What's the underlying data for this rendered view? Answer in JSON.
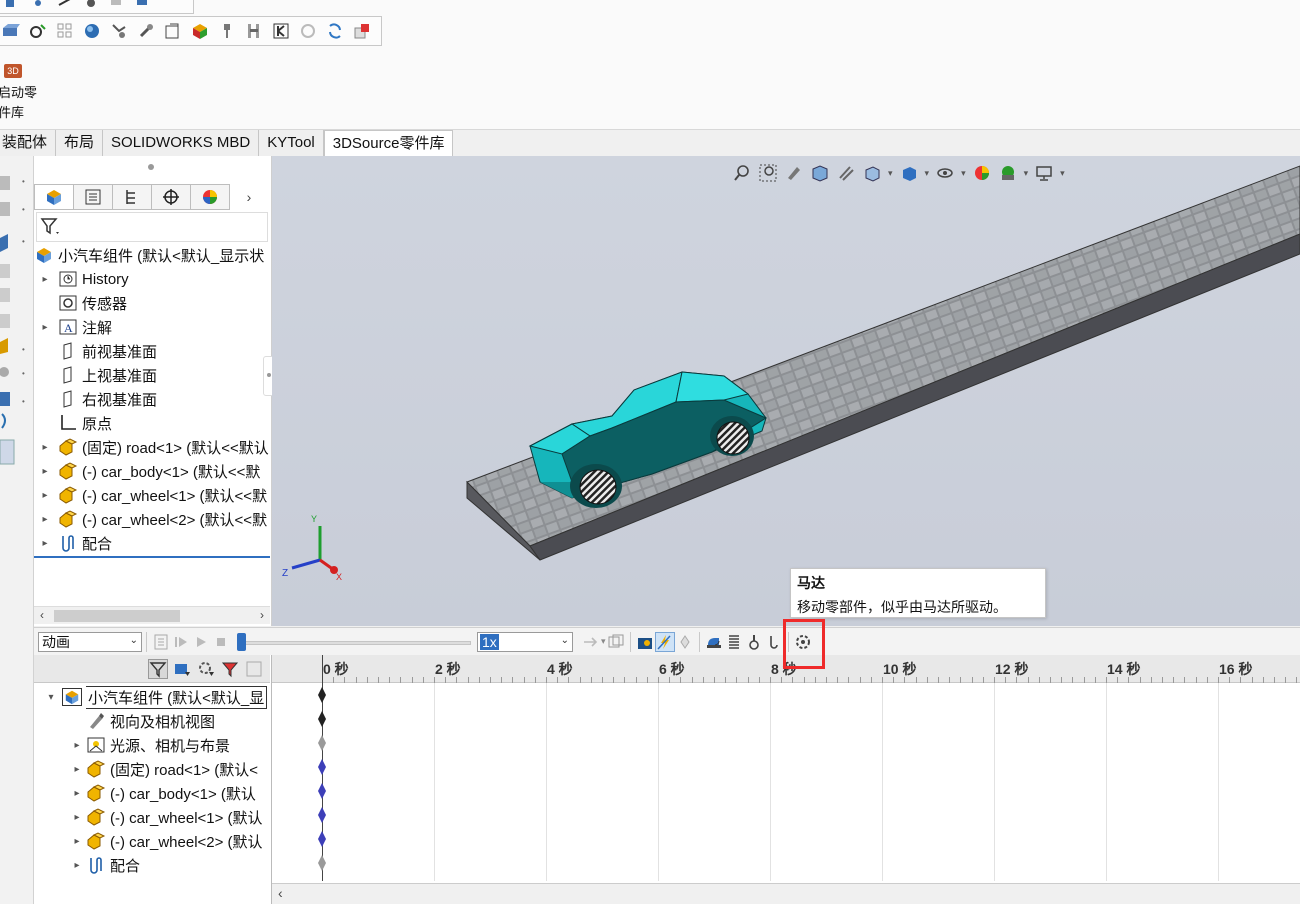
{
  "library_button": {
    "line1": "启动零",
    "line2": "件库",
    "badge": "3D"
  },
  "tabs": [
    {
      "label": "装配体",
      "active": false
    },
    {
      "label": "布局",
      "active": false
    },
    {
      "label": "SOLIDWORKS MBD",
      "active": false
    },
    {
      "label": "KYTool",
      "active": false
    },
    {
      "label": "3DSource零件库",
      "active": true
    }
  ],
  "feature_tree": {
    "root": "小汽车组件  (默认<默认_显示状",
    "items": [
      {
        "label": "History",
        "icon": "history-icon"
      },
      {
        "label": "传感器",
        "icon": "sensor-icon"
      },
      {
        "label": "注解",
        "icon": "annotation-icon"
      },
      {
        "label": "前视基准面",
        "icon": "plane-icon"
      },
      {
        "label": "上视基准面",
        "icon": "plane-icon"
      },
      {
        "label": "右视基准面",
        "icon": "plane-icon"
      },
      {
        "label": "原点",
        "icon": "origin-icon"
      },
      {
        "label": "(固定) road<1> (默认<<默认",
        "icon": "part-icon"
      },
      {
        "label": "(-) car_body<1> (默认<<默",
        "icon": "part-icon"
      },
      {
        "label": "(-) car_wheel<1> (默认<<默",
        "icon": "part-icon"
      },
      {
        "label": "(-) car_wheel<2> (默认<<默",
        "icon": "part-icon"
      },
      {
        "label": "配合",
        "icon": "mates-icon"
      }
    ]
  },
  "triad": {
    "x": "X",
    "y": "Y",
    "z": "Z"
  },
  "motion": {
    "study_type": "动画",
    "playback_speed": "1x",
    "tooltip_title": "马达",
    "tooltip_desc": "移动零部件，似乎由马达所驱动。",
    "time_labels": [
      "0 秒",
      "2 秒",
      "4 秒",
      "6 秒",
      "8 秒",
      "10 秒",
      "12 秒",
      "14 秒",
      "16 秒"
    ],
    "tree": [
      {
        "label": "小汽车组件  (默认<默认_显",
        "icon": "assembly-icon"
      },
      {
        "label": "视向及相机视图",
        "icon": "camera-icon"
      },
      {
        "label": "光源、相机与布景",
        "icon": "lights-icon"
      },
      {
        "label": "(固定) road<1> (默认<",
        "icon": "part-icon"
      },
      {
        "label": "(-) car_body<1> (默认",
        "icon": "part-icon"
      },
      {
        "label": "(-) car_wheel<1> (默认",
        "icon": "part-icon"
      },
      {
        "label": "(-) car_wheel<2> (默认",
        "icon": "part-icon"
      },
      {
        "label": "配合",
        "icon": "mates-icon"
      }
    ]
  },
  "colors": {
    "car": "#1fd0d2",
    "highlight": "#ef2a2a",
    "viewport": "#cbd0da"
  }
}
